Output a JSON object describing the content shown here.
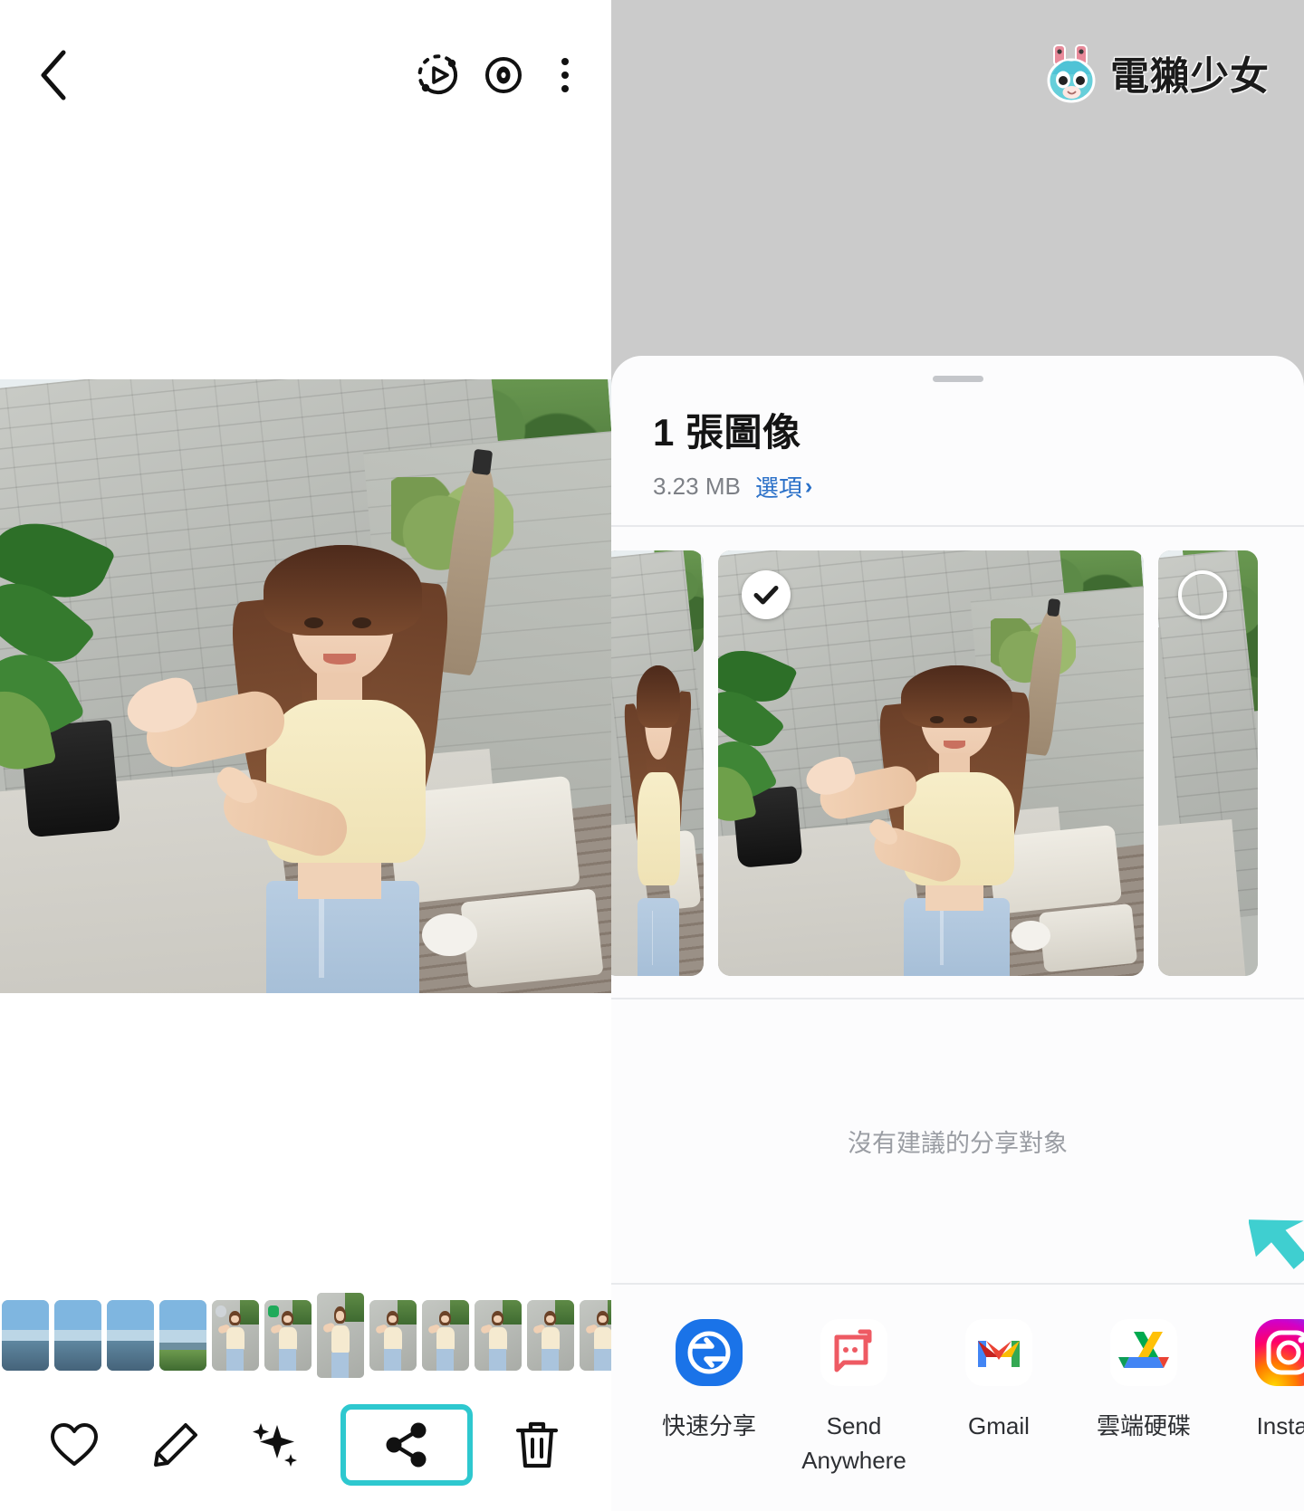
{
  "left_panel": {
    "topbar": {
      "back_icon": "chevron-left-icon",
      "motion_photo_icon": "motion-photo-play-icon",
      "view_icon": "eye-icon",
      "more_icon": "kebab-menu-icon"
    },
    "photo": {
      "alt": "woman-presenting-gesture-outdoor-terrace"
    },
    "filmstrip": {
      "count": 13,
      "active_index": 6
    },
    "actions": [
      {
        "name": "favorite-button",
        "icon": "heart-icon",
        "highlighted": false
      },
      {
        "name": "edit-button",
        "icon": "pencil-icon",
        "highlighted": false
      },
      {
        "name": "enhance-button",
        "icon": "sparkles-icon",
        "highlighted": false
      },
      {
        "name": "share-button",
        "icon": "share-icon",
        "highlighted": true
      },
      {
        "name": "delete-button",
        "icon": "trash-icon",
        "highlighted": false
      }
    ]
  },
  "right_panel": {
    "watermark": {
      "text": "電獺少女",
      "mark": "mascot-avatar-icon"
    },
    "share_sheet": {
      "grab_handle": "drag-handle",
      "title": "1 張圖像",
      "size": "3.23 MB",
      "options_label": "選項",
      "options_chevron": "›",
      "thumbnails": [
        {
          "selected": false,
          "badge": "none"
        },
        {
          "selected": true,
          "badge": "check-circle-filled"
        },
        {
          "selected": false,
          "badge": "circle-outline"
        }
      ],
      "no_suggestions": "沒有建議的分享對象",
      "apps": [
        {
          "label": "快速分享",
          "icon": "quick-share-icon",
          "color": "#1a73e8"
        },
        {
          "label": "Send Anywhere",
          "icon": "send-anywhere-icon",
          "color": "#ef5350"
        },
        {
          "label": "Gmail",
          "icon": "gmail-icon",
          "color": "#ea4335"
        },
        {
          "label": "雲端硬碟",
          "icon": "google-drive-icon",
          "color": "#fbbc04"
        },
        {
          "label": "Instag",
          "icon": "instagram-icon",
          "color": "#d6249f"
        }
      ]
    },
    "annotation": {
      "arrow": "cyan-pointer-arrow",
      "color": "#3fcfd0"
    }
  },
  "colors": {
    "highlight": "#2ec8cf",
    "sheet_bg": "#fcfcfd",
    "panel_bg": "#cbcbcb",
    "link": "#2a70c8",
    "muted_text": "#9a9da3"
  }
}
